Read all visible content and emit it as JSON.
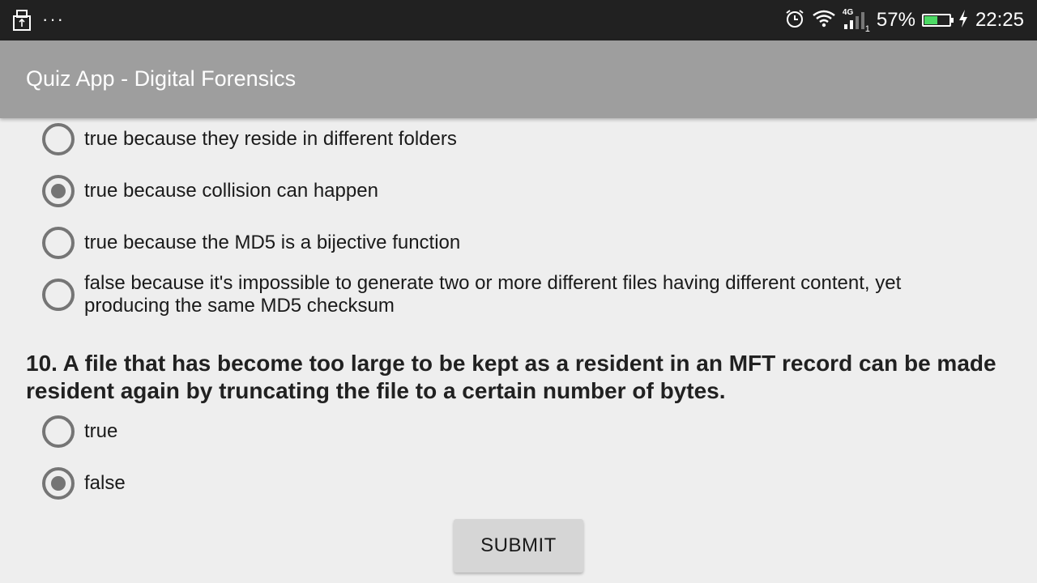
{
  "status_bar": {
    "battery_percent": "57%",
    "battery_level": 0.57,
    "time": "22:25",
    "network": "4G",
    "sim": "1",
    "colors": {
      "battery_fill": "#4cd964",
      "background": "#212121"
    }
  },
  "app_bar": {
    "title": "Quiz App - Digital Forensics",
    "color": "#9e9e9e"
  },
  "question9": {
    "options": [
      {
        "label": "true because they reside in different folders",
        "checked": false
      },
      {
        "label": "true because collision can happen",
        "checked": true
      },
      {
        "label": "true because the MD5 is a bijective function",
        "checked": false
      },
      {
        "label": "false because it's impossible to generate two or more different files having different content, yet producing the same MD5 checksum",
        "checked": false
      }
    ]
  },
  "question10": {
    "text": "10. A file that has become too large to be kept as a resident in an MFT record can be made resident again by truncating the file to a certain number of bytes.",
    "options": [
      {
        "label": "true",
        "checked": false
      },
      {
        "label": "false",
        "checked": true
      }
    ]
  },
  "submit_label": "SUBMIT"
}
